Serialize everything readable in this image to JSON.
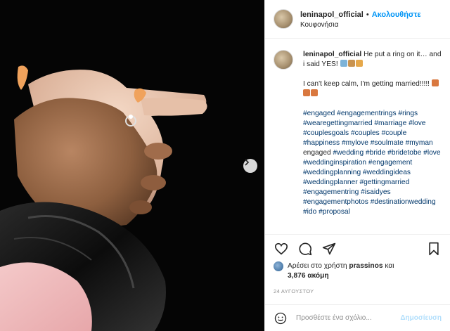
{
  "header": {
    "username": "leninapol_official",
    "separator": "•",
    "follow_label": "Ακολουθήστε",
    "location": "Κουφονήσια"
  },
  "caption": {
    "username": "leninapol_official",
    "line1": "He put a ring on it… and i said YES!",
    "line2": "I can't keep calm, I'm getting married!!!!!",
    "hashtags": [
      "#engaged",
      "#engagementrings",
      "#rings",
      "#wearegettingmarried",
      "#marriage",
      "#love",
      "#couplesgoals",
      "#couples",
      "#couple",
      "#happiness",
      "#mylove",
      "#soulmate",
      "#myman",
      "engaged",
      "#wedding",
      "#bride",
      "#bridetobe",
      "#love",
      "#weddinginspiration",
      "#engagement",
      "#weddingplanning",
      "#weddingideas",
      "#weddingplanner",
      "#gettingmarried",
      "#engagementring",
      "#isaidyes",
      "#engagementphotos",
      "#destinationwedding",
      "#ido",
      "#proposal"
    ]
  },
  "icons": {
    "like": "heart-icon",
    "comment": "comment-icon",
    "share": "share-icon",
    "save": "bookmark-icon",
    "next": "chevron-right-icon",
    "emoji": "smiley-icon"
  },
  "likes": {
    "prefix": "Αρέσει στο χρήστη",
    "user": "prassinos",
    "conjunction": "και",
    "count": "3,876 ακόμη"
  },
  "date": "24 ΑΥΓΟΥΣΤΟΥ",
  "comment_box": {
    "placeholder": "Προσθέστε ένα σχόλιο...",
    "publish_label": "Δημοσίευση"
  },
  "colors": {
    "accent": "#0095f6",
    "hashtag": "#00376b",
    "publish_disabled": "#b2dffc",
    "muted": "#8e8e8e"
  }
}
